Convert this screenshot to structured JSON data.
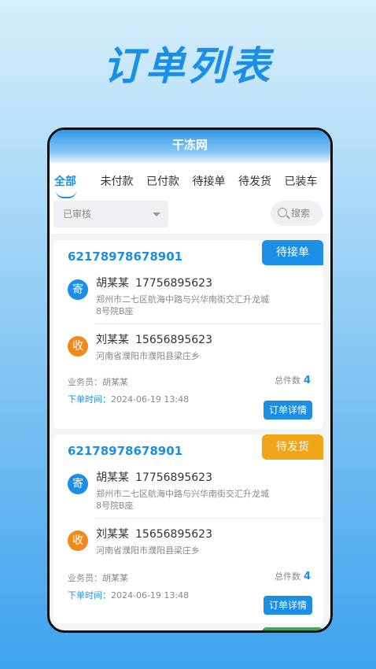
{
  "hero_title": "订单列表",
  "app": {
    "title": "干冻网",
    "tabs": [
      "全部",
      "未付款",
      "已付款",
      "待接单",
      "待发货",
      "已装车"
    ],
    "active_tab": 0,
    "filter": {
      "selected": "已审核"
    },
    "search": {
      "placeholder": "搜索"
    }
  },
  "orders": [
    {
      "order_no": "62178978678901",
      "status": "待接单",
      "status_color": "#1b8fe6",
      "sender": {
        "badge": "寄",
        "name": "胡某某",
        "phone": "17756895623",
        "address": "郑州市二七区航海中路与兴华南街交汇升龙城8号院B座"
      },
      "receiver": {
        "badge": "收",
        "name": "刘某某",
        "phone": "15656895623",
        "address": "河南省濮阳市濮阳县梁庄乡"
      },
      "salesperson_label": "业务员：",
      "salesperson": "胡某某",
      "total_label": "总件数",
      "total": "4",
      "time_label": "下单时间：",
      "time": "2024-06-19 13:48",
      "detail_label": "订单详情"
    },
    {
      "order_no": "62178978678901",
      "status": "待发货",
      "status_color": "#f0a417",
      "sender": {
        "badge": "寄",
        "name": "胡某某",
        "phone": "17756895623",
        "address": "郑州市二七区航海中路与兴华南街交汇升龙城8号院B座"
      },
      "receiver": {
        "badge": "收",
        "name": "刘某某",
        "phone": "15656895623",
        "address": "河南省濮阳市濮阳县梁庄乡"
      },
      "salesperson_label": "业务员：",
      "salesperson": "胡某某",
      "total_label": "总件数",
      "total": "4",
      "time_label": "下单时间：",
      "time": "2024-06-19 13:48",
      "detail_label": "订单详情"
    }
  ],
  "colors": {
    "sender_badge": "#1b8fe6",
    "receiver_badge": "#f08a1c",
    "accent": "#1b8fe6",
    "peek_status": "#2fb25b"
  }
}
